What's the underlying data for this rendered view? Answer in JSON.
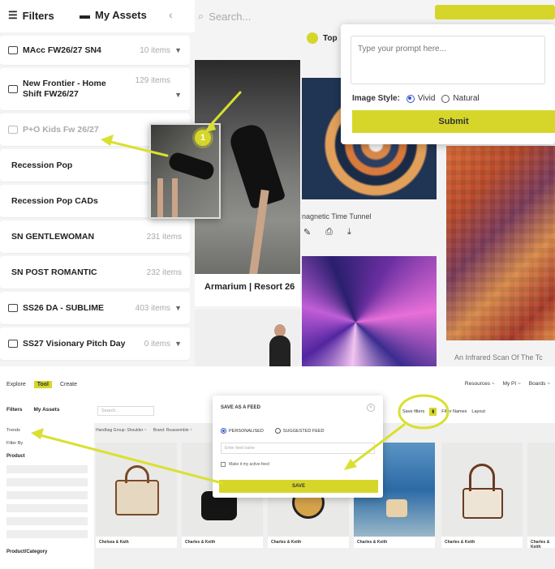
{
  "top_ui": {
    "header": {
      "filters_label": "Filters",
      "assets_label": "My Assets",
      "collapse_glyph": "‹",
      "search_placeholder": "Search..."
    },
    "collections": [
      {
        "name": "MAcc FW26/27 SN4",
        "count": "10 items"
      },
      {
        "name": "New Frontier - Home Shift FW26/27",
        "count": "129 items"
      },
      {
        "name": "P+O Kids Fw 26/27",
        "count": ""
      },
      {
        "name": "Recession Pop",
        "count": ""
      },
      {
        "name": "Recession Pop CADs",
        "count": ""
      },
      {
        "name": "SN GENTLEWOMAN",
        "count": "231 items"
      },
      {
        "name": "SN POST ROMANTIC",
        "count": "232 items"
      },
      {
        "name": "SS26 DA - SUBLIME",
        "count": "403 items"
      },
      {
        "name": "SS27 Visionary Pitch Day",
        "count": "0 items"
      }
    ],
    "badge_number": "1",
    "photo_caption": "Armarium | Resort 26",
    "top_tag": "Top",
    "tunnel_title": "nagnetic Time Tunnel",
    "pixel_title": "An Infrared Scan Of The Tc",
    "prompt_modal": {
      "placeholder": "Type your prompt here...",
      "style_label": "Image Style:",
      "option_vivid": "Vivid",
      "option_natural": "Natural",
      "submit_label": "Submit"
    }
  },
  "bottom_ui": {
    "nav": {
      "explore": "Explore",
      "tool": "Tool",
      "create": "Create",
      "resources": "Resources ~",
      "my_pi": "My PI ~",
      "boards": "Boards ~"
    },
    "bar": {
      "filters": "Filters",
      "my_assets": "My Assets",
      "search": "Search...",
      "save_filters": "Save filters",
      "filter_names": "Filter Names",
      "layout": "Layout"
    },
    "sidebar": {
      "trends": "Trends",
      "filter_by": "Filter By",
      "product": "Product",
      "product_category": "Product/Category"
    },
    "filter_row": [
      "Handbag Group: Shoulder ~",
      "Brand: Reassemble ~"
    ],
    "save_modal": {
      "title": "SAVE AS A FEED",
      "option_personalised": "PERSONALISED",
      "option_suggested": "SUGGESTED FEED",
      "name_placeholder": "Enter feed name",
      "checkbox_label": "Make it my active feed",
      "save_label": "SAVE"
    },
    "cards": [
      "Chelsea & Kath",
      "Charles & Keith",
      "Charles & Keith",
      "Charles & Keith",
      "Charles & Keith",
      "Charles & Keith"
    ]
  },
  "colors": {
    "accent": "#d6d62a",
    "annotation": "#d9e030"
  }
}
